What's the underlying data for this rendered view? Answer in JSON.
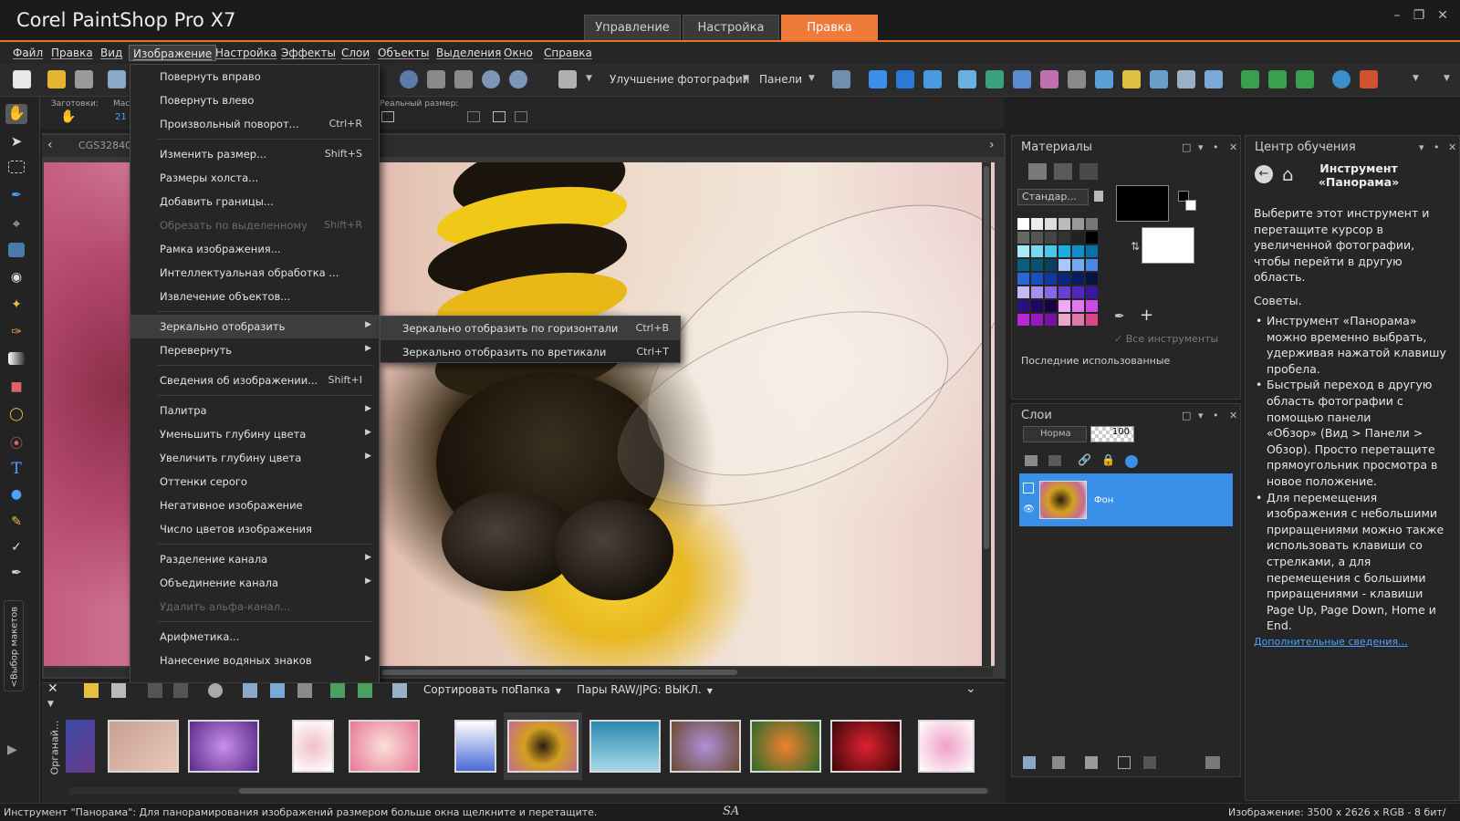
{
  "titlebar": {
    "app_title": "Corel PaintShop Pro X7",
    "tabs": [
      {
        "label": "Управление",
        "active": false
      },
      {
        "label": "Настройка",
        "active": false
      },
      {
        "label": "Правка",
        "active": true
      }
    ],
    "window_buttons": [
      "minimize",
      "restore",
      "close"
    ]
  },
  "menubar": {
    "items": [
      "Файл",
      "Правка",
      "Вид",
      "Изображение",
      "Настройка",
      "Эффекты",
      "Слои",
      "Объекты",
      "Выделения",
      "Окно",
      "Справка"
    ],
    "open_item": "Изображение"
  },
  "toolbar": {
    "enhance_label": "Улучшение фотографии",
    "panels_label": "Панели"
  },
  "options_bar": {
    "presets_label": "Заготовки:",
    "zoom_label": "Мас",
    "zoom_value": "21",
    "actual_size_label": "Реальный размер:"
  },
  "document": {
    "tab_title": "CGS32840"
  },
  "image_menu": {
    "items": [
      {
        "label": "Повернуть вправо",
        "shortcut": "",
        "submenu": false,
        "disabled": false
      },
      {
        "label": "Повернуть влево",
        "shortcut": "",
        "submenu": false,
        "disabled": false
      },
      {
        "label": "Произвольный поворот...",
        "shortcut": "Ctrl+R",
        "submenu": false,
        "disabled": false
      },
      {
        "label": "Изменить размер...",
        "shortcut": "Shift+S",
        "submenu": false,
        "disabled": false
      },
      {
        "label": "Размеры холста...",
        "shortcut": "",
        "submenu": false,
        "disabled": false
      },
      {
        "label": "Добавить границы...",
        "shortcut": "",
        "submenu": false,
        "disabled": false
      },
      {
        "label": "Обрезать по выделенному",
        "shortcut": "Shift+R",
        "submenu": false,
        "disabled": true
      },
      {
        "label": "Рамка изображения...",
        "shortcut": "",
        "submenu": false,
        "disabled": false
      },
      {
        "label": "Интеллектуальная обработка ...",
        "shortcut": "",
        "submenu": false,
        "disabled": false
      },
      {
        "label": "Извлечение объектов...",
        "shortcut": "",
        "submenu": false,
        "disabled": false
      },
      {
        "label": "Зеркально отобразить",
        "shortcut": "",
        "submenu": true,
        "disabled": false
      },
      {
        "label": "Перевернуть",
        "shortcut": "",
        "submenu": true,
        "disabled": false
      },
      {
        "label": "Сведения об изображении...",
        "shortcut": "Shift+I",
        "submenu": false,
        "disabled": false
      },
      {
        "label": "Палитра",
        "shortcut": "",
        "submenu": true,
        "disabled": false
      },
      {
        "label": "Уменьшить глубину цвета",
        "shortcut": "",
        "submenu": true,
        "disabled": false
      },
      {
        "label": "Увеличить глубину цвета",
        "shortcut": "",
        "submenu": true,
        "disabled": false
      },
      {
        "label": "Оттенки серого",
        "shortcut": "",
        "submenu": false,
        "disabled": false
      },
      {
        "label": "Негативное изображение",
        "shortcut": "",
        "submenu": false,
        "disabled": false
      },
      {
        "label": "Число цветов изображения",
        "shortcut": "",
        "submenu": false,
        "disabled": false
      },
      {
        "label": "Разделение канала",
        "shortcut": "",
        "submenu": true,
        "disabled": false
      },
      {
        "label": "Объединение канала",
        "shortcut": "",
        "submenu": true,
        "disabled": false
      },
      {
        "label": "Удалить альфа-канал...",
        "shortcut": "",
        "submenu": false,
        "disabled": true
      },
      {
        "label": "Арифметика...",
        "shortcut": "",
        "submenu": false,
        "disabled": false
      },
      {
        "label": "Нанесение водяных знаков",
        "shortcut": "",
        "submenu": true,
        "disabled": false
      }
    ],
    "highlighted": "Зеркально отобразить"
  },
  "mirror_submenu": {
    "items": [
      {
        "label": "Зеркально отобразить по горизонтали",
        "shortcut": "Ctrl+B"
      },
      {
        "label": "Зеркально отобразить по вретикали",
        "shortcut": "Ctrl+T"
      }
    ]
  },
  "materials_panel": {
    "title": "Материалы",
    "palette_select": "Стандар...",
    "all_tools": "Все инструменты",
    "recent": "Последние использованные",
    "foreground_color": "#000000",
    "background_color": "#ffffff"
  },
  "layers_panel": {
    "title": "Слои",
    "blend_mode": "Норма",
    "opacity": "100",
    "layers": [
      {
        "name": "Фон",
        "selected": true
      }
    ]
  },
  "learning_panel": {
    "title": "Центр обучения",
    "heading_line1": "Инструмент",
    "heading_line2": "«Панорама»",
    "intro_lines": [
      "Выберите этот инструмент и",
      "перетащите курсор в",
      "увеличенной фотографии,",
      "чтобы перейти в другую",
      "область."
    ],
    "tips_title": "Советы.",
    "tips": [
      [
        "Инструмент «Панорама»",
        "можно временно выбрать,",
        "удерживая нажатой клавишу",
        "пробела."
      ],
      [
        "Быстрый переход в другую",
        "область фотографии с",
        "помощью панели",
        "«Обзор» (Вид > Панели >",
        "Обзор). Просто перетащите",
        "прямоугольник просмотра в",
        "новое положение."
      ],
      [
        "Для перемещения",
        "изображения с небольшими",
        "приращениями можно также",
        "использовать клавиши со",
        "стрелками, а для",
        "перемещения с большими",
        "приращениями - клавиши",
        "Page Up, Page Down, Home и",
        "End."
      ]
    ],
    "more_link": "Дополнительные сведения..."
  },
  "organizer": {
    "side_label": "Органай...",
    "sort_label": "Сортировать по:",
    "sort_value": "Папка",
    "raw_pairs": "Пары RAW/JPG: ВЫКЛ.",
    "selected_index": 6
  },
  "toolbox": {
    "side_label": "<Выбор макетов"
  },
  "statusbar": {
    "hint": "Инструмент \"Панорама\": Для панорамирования изображений размером больше окна щелкните и перетащите.",
    "watermark": "SA",
    "image_info": "Изображение: 3500 x 2626 x RGB - 8 бит/канал"
  },
  "colors": {
    "accent": "#f07a3a",
    "selection_blue": "#3a8fe8",
    "link": "#4aa3ff"
  }
}
